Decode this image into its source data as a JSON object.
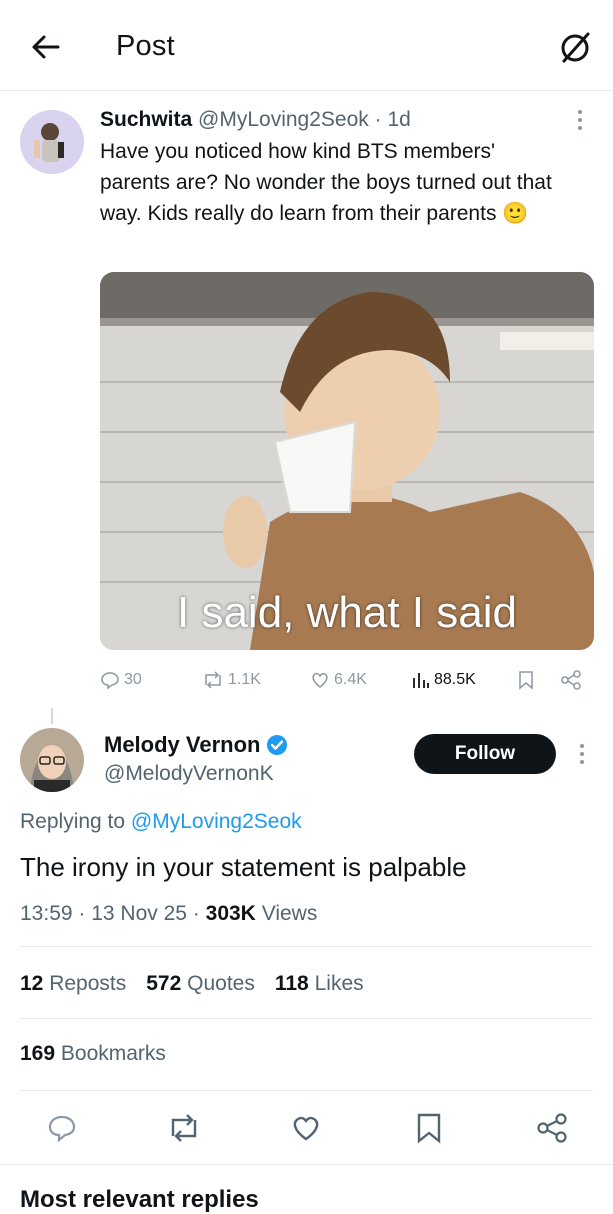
{
  "header": {
    "title": "Post"
  },
  "original_tweet": {
    "display_name": "Suchwita",
    "handle": "@MyLoving2Seok",
    "separator": "·",
    "age": "1d",
    "text": "Have you noticed how kind BTS members' parents are? No wonder the boys turned out that way. Kids really do learn from their parents",
    "emoji": "🙂",
    "image_caption": "I said, what I said",
    "stats": {
      "replies": "30",
      "reposts": "1.1K",
      "likes": "6.4K",
      "views": "88.5K"
    }
  },
  "reply": {
    "display_name": "Melody Vernon",
    "handle": "@MelodyVernonK",
    "follow_label": "Follow",
    "replying_prefix": "Replying to",
    "replying_handle": "@MyLoving2Seok",
    "text": "The irony in your statement is palpable",
    "time": "13:59",
    "date": "13 Nov 25",
    "views_count": "303K",
    "views_label": "Views",
    "reposts_count": "12",
    "reposts_label": "Reposts",
    "quotes_count": "572",
    "quotes_label": "Quotes",
    "likes_count": "118",
    "likes_label": "Likes",
    "bookmarks_count": "169",
    "bookmarks_label": "Bookmarks"
  },
  "footer": {
    "cut_text": "Most relevant replies"
  },
  "icons": [
    "back-arrow-icon",
    "grok-icon",
    "more-icon",
    "comment-icon",
    "repost-icon",
    "like-icon",
    "views-icon",
    "bookmark-icon",
    "share-icon",
    "verified-badge-icon"
  ],
  "colors": {
    "accent": "#1d9bf0",
    "text": "#0f1419",
    "muted": "#536471"
  }
}
